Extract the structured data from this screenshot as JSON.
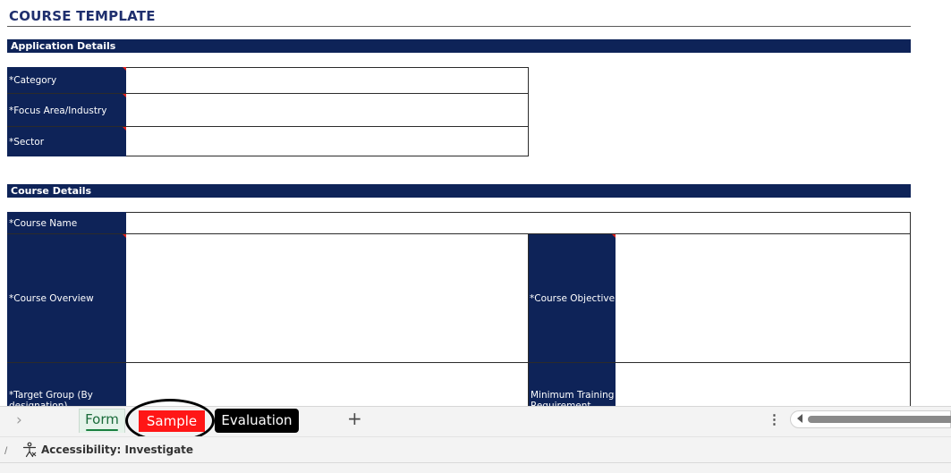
{
  "sheet": {
    "title": "COURSE TEMPLATE",
    "application_details": {
      "header": "Application Details",
      "fields": [
        {
          "label": "*Category",
          "value": ""
        },
        {
          "label": "*Focus Area/Industry",
          "value": ""
        },
        {
          "label": "*Sector",
          "value": ""
        }
      ]
    },
    "course_details": {
      "header": "Course Details",
      "course_name_label": "*Course Name",
      "course_overview_label": "*Course Overview",
      "course_objective_label": "*Course Objective",
      "target_group_label": "*Target Group (By designation)",
      "minimum_training_label": "Minimum Training Requirement"
    }
  },
  "tabs": {
    "prev_icon": "chevron-right-icon",
    "items": [
      {
        "label": "Form",
        "active": true
      },
      {
        "label": "Sample",
        "highlight_color": "#ff1616"
      },
      {
        "label": "Evaluation",
        "highlight_color": "#000000"
      }
    ],
    "add_label": "+",
    "more_label": "⋮"
  },
  "status": {
    "separator": "/",
    "accessibility": "Accessibility: Investigate"
  },
  "colors": {
    "band": "#0e2358",
    "title": "#1f2f6e",
    "required_marker": "#e0201b"
  }
}
